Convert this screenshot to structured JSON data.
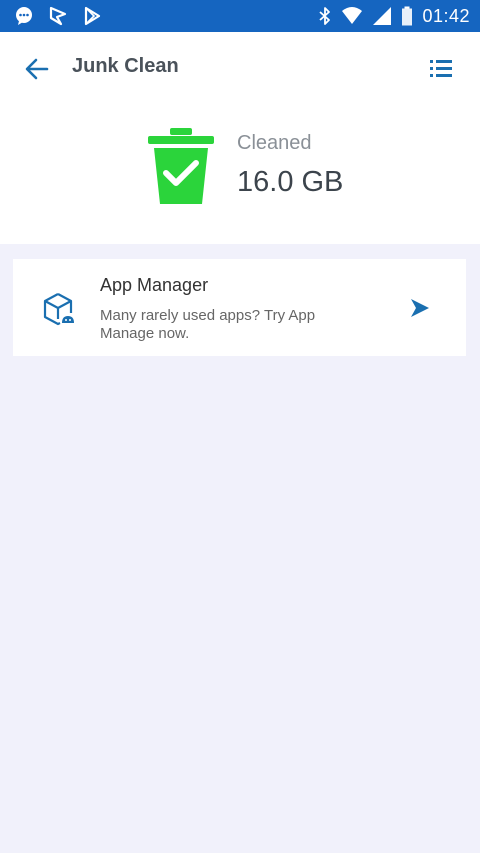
{
  "status_bar": {
    "time": "01:42",
    "left_icons": [
      "message-icon",
      "flag-icon",
      "play-store-icon"
    ],
    "right_icons": [
      "bluetooth-icon",
      "wifi-icon",
      "signal-icon",
      "battery-icon"
    ],
    "background": "#1565c0"
  },
  "app_bar": {
    "title": "Junk Clean",
    "back_icon": "arrow-left-icon",
    "menu_icon": "list-icon",
    "accent": "#1a6fb0"
  },
  "result": {
    "label": "Cleaned",
    "value": "16.0 GB",
    "icon": "trash-check-icon",
    "icon_color": "#2bd43b"
  },
  "card": {
    "title": "App Manager",
    "description": "Many rarely used apps? Try App Manage now.",
    "icon": "app-box-icon",
    "arrow_icon": "send-arrow-icon"
  }
}
